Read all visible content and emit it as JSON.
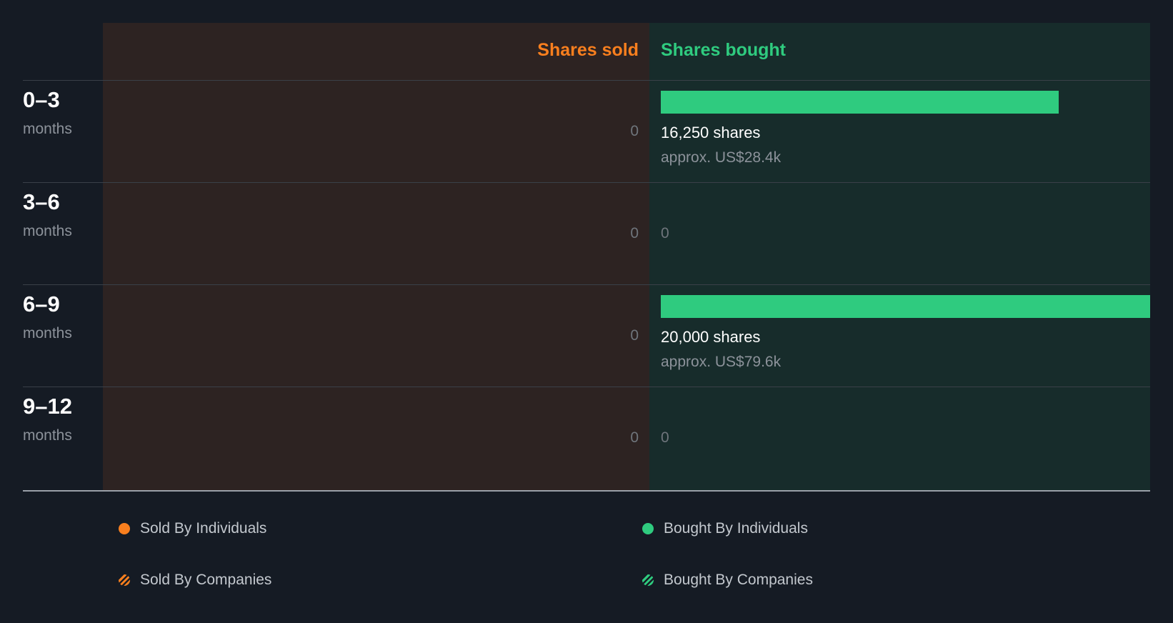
{
  "chart_data": {
    "type": "bar",
    "orientation": "horizontal",
    "headers": {
      "sold": "Shares sold",
      "bought": "Shares bought"
    },
    "unit_label": "months",
    "categories": [
      "0–3",
      "3–6",
      "6–9",
      "9–12"
    ],
    "series": [
      {
        "name": "Shares sold",
        "values": [
          0,
          0,
          0,
          0
        ],
        "labels": [
          "0",
          "0",
          "0",
          "0"
        ],
        "value_labels": [
          "",
          "",
          "",
          ""
        ]
      },
      {
        "name": "Shares bought",
        "values": [
          16250,
          0,
          20000,
          0
        ],
        "labels": [
          "16,250 shares",
          "0",
          "20,000 shares",
          "0"
        ],
        "value_labels": [
          "approx. US$28.4k",
          "",
          "approx. US$79.6k",
          ""
        ]
      }
    ],
    "xlim": [
      0,
      20000
    ]
  },
  "legend": [
    {
      "label": "Sold By Individuals",
      "style": "dot",
      "color": "#f97f1e"
    },
    {
      "label": "Bought By Individuals",
      "style": "dot",
      "color": "#2fcb7f"
    },
    {
      "label": "Sold By Companies",
      "style": "hatch",
      "color": "#f97f1e"
    },
    {
      "label": "Bought By Companies",
      "style": "hatch",
      "color": "#2fcb7f"
    }
  ],
  "colors": {
    "sold": "#f97f1e",
    "bought": "#2fcb7f",
    "sold_panel": "#2d2322",
    "bought_panel": "#172c2b",
    "background": "#151b24"
  }
}
